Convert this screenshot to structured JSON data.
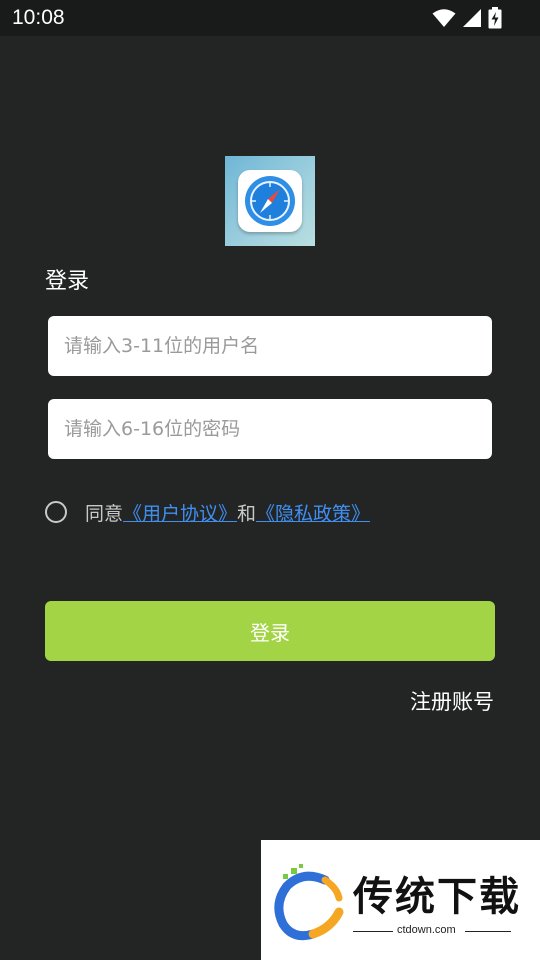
{
  "status_bar": {
    "time": "10:08",
    "icons": [
      "wifi-icon",
      "signal-icon",
      "battery-charging-icon"
    ]
  },
  "app": {
    "logo_icon": "compass-icon",
    "title": "登录"
  },
  "form": {
    "username_placeholder": "请输入3-11位的用户名",
    "password_placeholder": "请输入6-16位的密码",
    "username_value": "",
    "password_value": ""
  },
  "agreement": {
    "checked": false,
    "prefix": "同意",
    "user_agreement_link": "《用户协议》",
    "connector": "和",
    "privacy_policy_link": "《隐私政策》"
  },
  "actions": {
    "login_label": "登录",
    "register_label": "注册账号"
  },
  "watermark": {
    "title": "传统下载",
    "subtitle": "ctdown.com"
  },
  "colors": {
    "background": "#232525",
    "status_bar": "#191b1b",
    "accent_button": "#a2d445",
    "link": "#3f8ff2"
  }
}
